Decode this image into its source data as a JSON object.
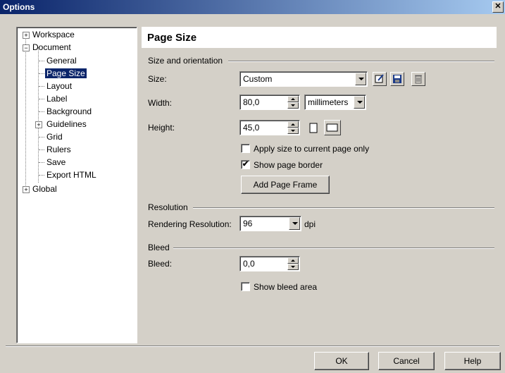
{
  "window": {
    "title": "Options",
    "close_glyph": "✕"
  },
  "tree": {
    "workspace": "Workspace",
    "document": "Document",
    "general": "General",
    "page_size": "Page Size",
    "layout": "Layout",
    "label": "Label",
    "background": "Background",
    "guidelines": "Guidelines",
    "grid": "Grid",
    "rulers": "Rulers",
    "save": "Save",
    "export_html": "Export HTML",
    "global": "Global"
  },
  "panel": {
    "title": "Page Size",
    "size_orientation_header": "Size and orientation",
    "size_label": "Size:",
    "size_value": "Custom",
    "width_label": "Width:",
    "width_value": "80,0",
    "units_value": "millimeters",
    "height_label": "Height:",
    "height_value": "45,0",
    "apply_size_label": "Apply size to current page only",
    "apply_size_checked": false,
    "show_border_label": "Show page border",
    "show_border_checked": true,
    "add_frame_label": "Add Page Frame",
    "resolution_header": "Resolution",
    "rendering_label": "Rendering Resolution:",
    "rendering_value": "96",
    "dpi_label": "dpi",
    "bleed_header": "Bleed",
    "bleed_label": "Bleed:",
    "bleed_value": "0,0",
    "show_bleed_label": "Show bleed area",
    "show_bleed_checked": false
  },
  "footer": {
    "ok": "OK",
    "cancel": "Cancel",
    "help": "Help"
  },
  "icons": {
    "edit": "edit-size-icon",
    "save": "save-icon",
    "delete": "delete-icon",
    "portrait": "portrait-icon",
    "landscape": "landscape-icon"
  }
}
